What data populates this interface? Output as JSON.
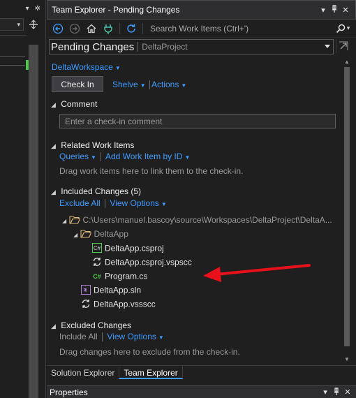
{
  "window": {
    "title": "Team Explorer - Pending Changes",
    "dropdown_glyph": "▾",
    "pin_glyph": "⊥",
    "close_glyph": "✕"
  },
  "left_strip": {
    "dropdown_glyph": "▾",
    "gear_glyph": "✲"
  },
  "toolbar": {
    "search_placeholder": "Search Work Items (Ctrl+')",
    "search_icon": "⌕",
    "search_dropdown": "▾"
  },
  "header": {
    "title": "Pending Changes",
    "project": "DeltaProject"
  },
  "workspace": {
    "label": "DeltaWorkspace"
  },
  "actions": {
    "check_in": "Check In",
    "shelve": "Shelve",
    "actions": "Actions"
  },
  "comment": {
    "heading": "Comment",
    "placeholder": "Enter a check-in comment"
  },
  "related": {
    "heading": "Related Work Items",
    "queries": "Queries",
    "add_work_item": "Add Work Item by ID",
    "hint": "Drag work items here to link them to the check-in."
  },
  "included": {
    "heading": "Included Changes (5)",
    "exclude_all": "Exclude All",
    "view_options": "View Options",
    "root_path": "C:\\Users\\manuel.bascoy\\source\\Workspaces\\DeltaProject\\DeltaA...",
    "folder": "DeltaApp",
    "items": [
      {
        "name": "DeltaApp.csproj",
        "icon": "csproj"
      },
      {
        "name": "DeltaApp.csproj.vspscc",
        "icon": "sync"
      },
      {
        "name": "Program.cs",
        "icon": "csharp"
      }
    ],
    "root_items": [
      {
        "name": "DeltaApp.sln",
        "icon": "sln"
      },
      {
        "name": "DeltaApp.vssscc",
        "icon": "sync"
      }
    ]
  },
  "excluded": {
    "heading": "Excluded Changes",
    "include_all": "Include All",
    "view_options": "View Options",
    "hint": "Drag changes here to exclude from the check-in."
  },
  "tabs": [
    "Solution Explorer",
    "Team Explorer"
  ],
  "properties": {
    "title": "Properties"
  },
  "colors": {
    "link": "#3e9bff",
    "arrow": "#e8101a",
    "background": "#1f1f1f"
  }
}
